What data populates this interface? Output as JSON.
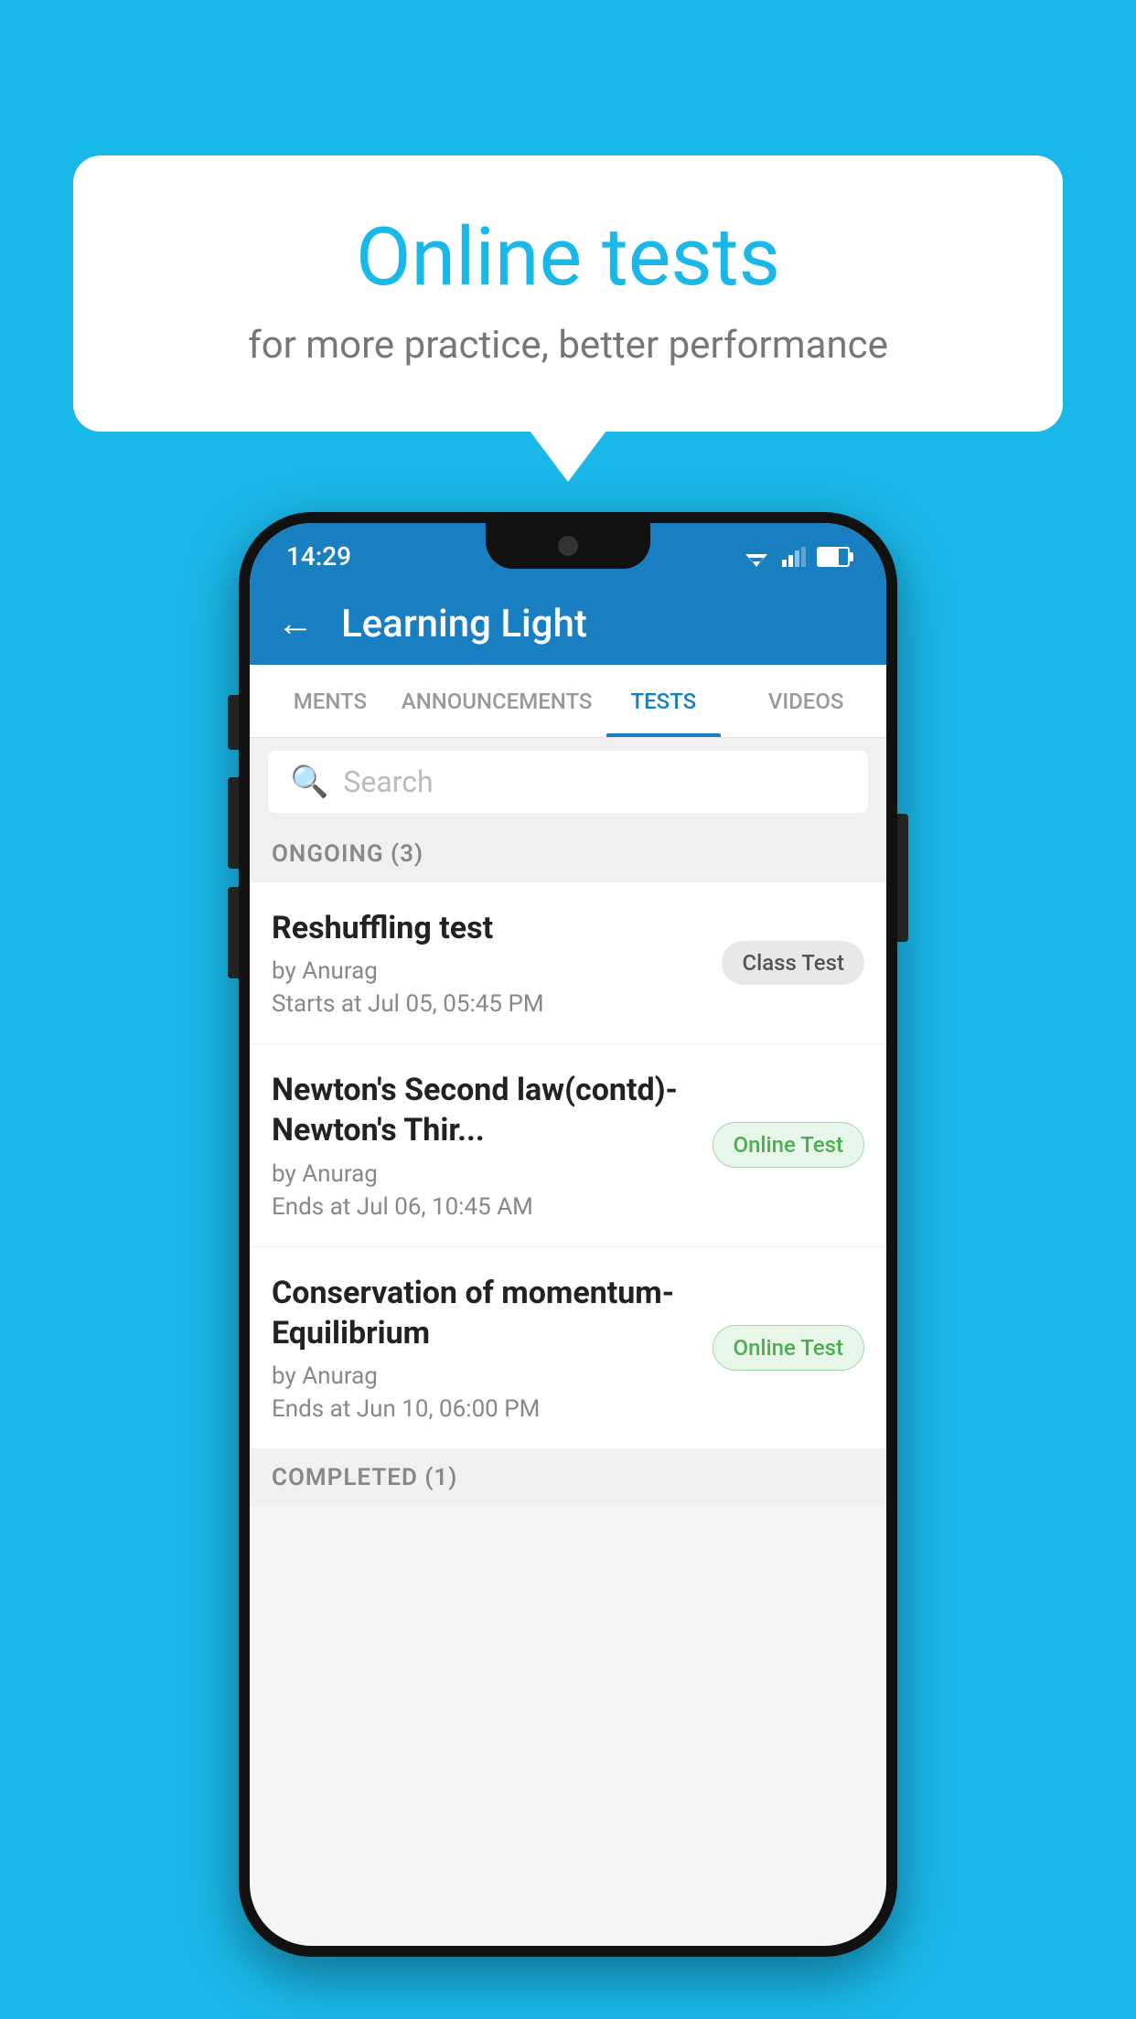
{
  "background": {
    "color": "#1ab8e8"
  },
  "bubble": {
    "title": "Online tests",
    "subtitle": "for more practice, better performance"
  },
  "phone": {
    "status_bar": {
      "time": "14:29"
    },
    "app_bar": {
      "title": "Learning Light",
      "back_label": "←"
    },
    "tabs": [
      {
        "label": "MENTS",
        "active": false
      },
      {
        "label": "ANNOUNCEMENTS",
        "active": false
      },
      {
        "label": "TESTS",
        "active": true
      },
      {
        "label": "VIDEOS",
        "active": false
      }
    ],
    "search": {
      "placeholder": "Search"
    },
    "ongoing_section": {
      "label": "ONGOING (3)"
    },
    "tests": [
      {
        "title": "Reshuffling test",
        "author": "by Anurag",
        "date": "Starts at  Jul 05, 05:45 PM",
        "badge": "Class Test",
        "badge_type": "class"
      },
      {
        "title": "Newton's Second law(contd)-Newton's Thir...",
        "author": "by Anurag",
        "date": "Ends at  Jul 06, 10:45 AM",
        "badge": "Online Test",
        "badge_type": "online"
      },
      {
        "title": "Conservation of momentum-Equilibrium",
        "author": "by Anurag",
        "date": "Ends at  Jun 10, 06:00 PM",
        "badge": "Online Test",
        "badge_type": "online"
      }
    ],
    "completed_section": {
      "label": "COMPLETED (1)"
    }
  }
}
